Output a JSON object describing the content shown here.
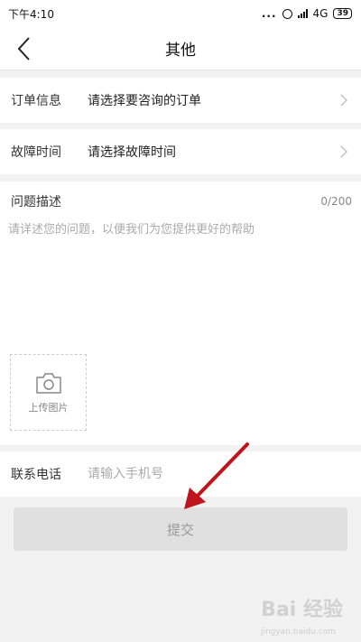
{
  "status_bar": {
    "time": "下午4:10",
    "dots": "...",
    "network": "4G",
    "battery": "39"
  },
  "header": {
    "title": "其他"
  },
  "order_row": {
    "label": "订单信息",
    "value": "请选择要咨询的订单"
  },
  "time_row": {
    "label": "故障时间",
    "value": "请选择故障时间"
  },
  "description": {
    "label": "问题描述",
    "counter": "0/200",
    "placeholder": "请详述您的问题，以便我们为您提供更好的帮助",
    "value": ""
  },
  "upload": {
    "label": "上传图片"
  },
  "phone_row": {
    "label": "联系电话",
    "placeholder": "请输入手机号",
    "value": ""
  },
  "submit": {
    "label": "提交"
  },
  "watermark": {
    "text": "Bai 经验",
    "sub": "jingyan.baidu.com"
  },
  "colors": {
    "annotation_arrow": "#c0141c",
    "page_background": "#f2f2f2",
    "submit_disabled_bg": "#e0e0e0"
  }
}
